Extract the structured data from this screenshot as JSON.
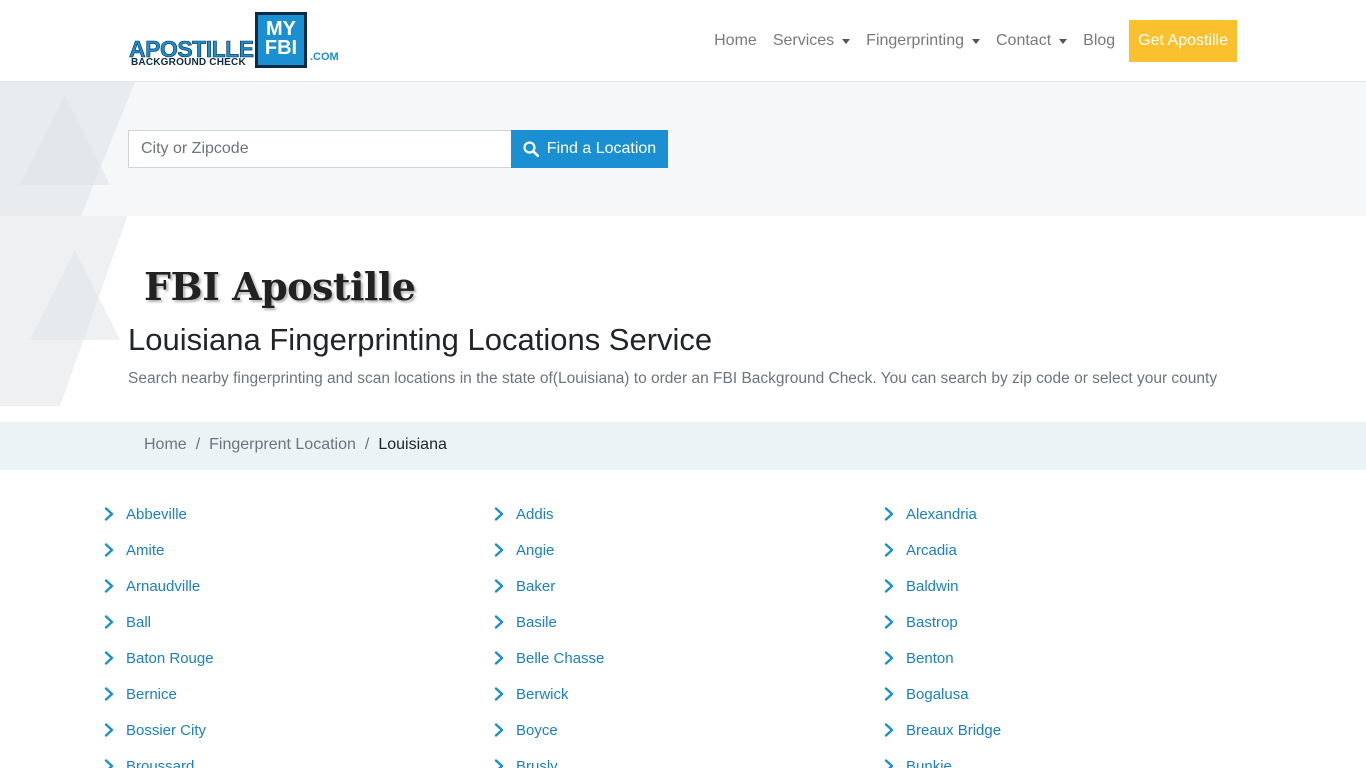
{
  "header": {
    "logo": {
      "main": "APOSTILLE",
      "sub": "BACKGROUND CHECK",
      "box_line1": "MY",
      "box_line2": "FBI",
      "dotcom": ".COM"
    },
    "nav": {
      "home": "Home",
      "services": "Services",
      "fingerprinting": "Fingerprinting",
      "contact": "Contact",
      "blog": "Blog",
      "cta": "Get Apostille"
    },
    "accent_color": "#fbc02d",
    "brand_color": "#1a8fd1"
  },
  "search": {
    "placeholder": "City or Zipcode",
    "button_label": "Find a Location"
  },
  "hero": {
    "brand_title": "FBI Apostille",
    "title": "Louisiana Fingerprinting Locations Service",
    "description": "Search nearby fingerprinting and scan locations in the state of(Louisiana) to order an FBI Background Check. You can search by zip code or select your county"
  },
  "breadcrumb": {
    "items": [
      "Home",
      "Fingerprent Location"
    ],
    "active": "Louisiana"
  },
  "locations": [
    "Abbeville",
    "Addis",
    "Alexandria",
    "Amite",
    "Angie",
    "Arcadia",
    "Arnaudville",
    "Baker",
    "Baldwin",
    "Ball",
    "Basile",
    "Bastrop",
    "Baton Rouge",
    "Belle Chasse",
    "Benton",
    "Bernice",
    "Berwick",
    "Bogalusa",
    "Bossier City",
    "Boyce",
    "Breaux Bridge",
    "Broussard",
    "Brusly",
    "Bunkie"
  ]
}
